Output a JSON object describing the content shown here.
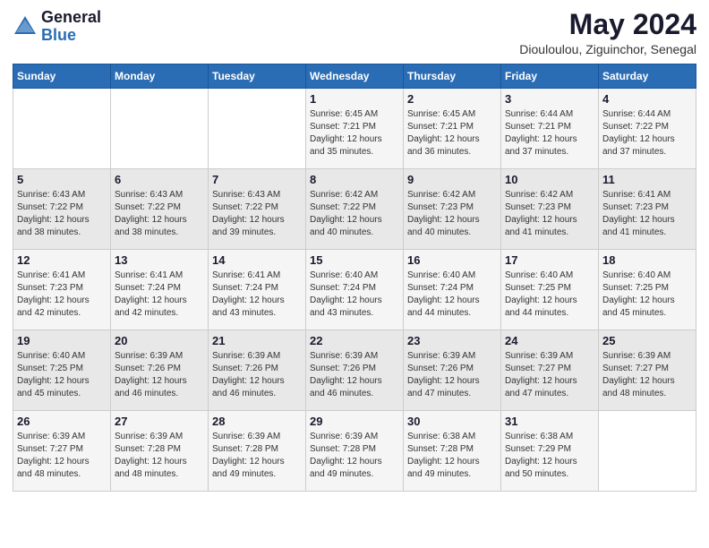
{
  "header": {
    "logo_general": "General",
    "logo_blue": "Blue",
    "title": "May 2024",
    "location": "Diouloulou, Ziguinchor, Senegal"
  },
  "days_of_week": [
    "Sunday",
    "Monday",
    "Tuesday",
    "Wednesday",
    "Thursday",
    "Friday",
    "Saturday"
  ],
  "weeks": [
    [
      {
        "day": "",
        "info": ""
      },
      {
        "day": "",
        "info": ""
      },
      {
        "day": "",
        "info": ""
      },
      {
        "day": "1",
        "info": "Sunrise: 6:45 AM\nSunset: 7:21 PM\nDaylight: 12 hours\nand 35 minutes."
      },
      {
        "day": "2",
        "info": "Sunrise: 6:45 AM\nSunset: 7:21 PM\nDaylight: 12 hours\nand 36 minutes."
      },
      {
        "day": "3",
        "info": "Sunrise: 6:44 AM\nSunset: 7:21 PM\nDaylight: 12 hours\nand 37 minutes."
      },
      {
        "day": "4",
        "info": "Sunrise: 6:44 AM\nSunset: 7:22 PM\nDaylight: 12 hours\nand 37 minutes."
      }
    ],
    [
      {
        "day": "5",
        "info": "Sunrise: 6:43 AM\nSunset: 7:22 PM\nDaylight: 12 hours\nand 38 minutes."
      },
      {
        "day": "6",
        "info": "Sunrise: 6:43 AM\nSunset: 7:22 PM\nDaylight: 12 hours\nand 38 minutes."
      },
      {
        "day": "7",
        "info": "Sunrise: 6:43 AM\nSunset: 7:22 PM\nDaylight: 12 hours\nand 39 minutes."
      },
      {
        "day": "8",
        "info": "Sunrise: 6:42 AM\nSunset: 7:22 PM\nDaylight: 12 hours\nand 40 minutes."
      },
      {
        "day": "9",
        "info": "Sunrise: 6:42 AM\nSunset: 7:23 PM\nDaylight: 12 hours\nand 40 minutes."
      },
      {
        "day": "10",
        "info": "Sunrise: 6:42 AM\nSunset: 7:23 PM\nDaylight: 12 hours\nand 41 minutes."
      },
      {
        "day": "11",
        "info": "Sunrise: 6:41 AM\nSunset: 7:23 PM\nDaylight: 12 hours\nand 41 minutes."
      }
    ],
    [
      {
        "day": "12",
        "info": "Sunrise: 6:41 AM\nSunset: 7:23 PM\nDaylight: 12 hours\nand 42 minutes."
      },
      {
        "day": "13",
        "info": "Sunrise: 6:41 AM\nSunset: 7:24 PM\nDaylight: 12 hours\nand 42 minutes."
      },
      {
        "day": "14",
        "info": "Sunrise: 6:41 AM\nSunset: 7:24 PM\nDaylight: 12 hours\nand 43 minutes."
      },
      {
        "day": "15",
        "info": "Sunrise: 6:40 AM\nSunset: 7:24 PM\nDaylight: 12 hours\nand 43 minutes."
      },
      {
        "day": "16",
        "info": "Sunrise: 6:40 AM\nSunset: 7:24 PM\nDaylight: 12 hours\nand 44 minutes."
      },
      {
        "day": "17",
        "info": "Sunrise: 6:40 AM\nSunset: 7:25 PM\nDaylight: 12 hours\nand 44 minutes."
      },
      {
        "day": "18",
        "info": "Sunrise: 6:40 AM\nSunset: 7:25 PM\nDaylight: 12 hours\nand 45 minutes."
      }
    ],
    [
      {
        "day": "19",
        "info": "Sunrise: 6:40 AM\nSunset: 7:25 PM\nDaylight: 12 hours\nand 45 minutes."
      },
      {
        "day": "20",
        "info": "Sunrise: 6:39 AM\nSunset: 7:26 PM\nDaylight: 12 hours\nand 46 minutes."
      },
      {
        "day": "21",
        "info": "Sunrise: 6:39 AM\nSunset: 7:26 PM\nDaylight: 12 hours\nand 46 minutes."
      },
      {
        "day": "22",
        "info": "Sunrise: 6:39 AM\nSunset: 7:26 PM\nDaylight: 12 hours\nand 46 minutes."
      },
      {
        "day": "23",
        "info": "Sunrise: 6:39 AM\nSunset: 7:26 PM\nDaylight: 12 hours\nand 47 minutes."
      },
      {
        "day": "24",
        "info": "Sunrise: 6:39 AM\nSunset: 7:27 PM\nDaylight: 12 hours\nand 47 minutes."
      },
      {
        "day": "25",
        "info": "Sunrise: 6:39 AM\nSunset: 7:27 PM\nDaylight: 12 hours\nand 48 minutes."
      }
    ],
    [
      {
        "day": "26",
        "info": "Sunrise: 6:39 AM\nSunset: 7:27 PM\nDaylight: 12 hours\nand 48 minutes."
      },
      {
        "day": "27",
        "info": "Sunrise: 6:39 AM\nSunset: 7:28 PM\nDaylight: 12 hours\nand 48 minutes."
      },
      {
        "day": "28",
        "info": "Sunrise: 6:39 AM\nSunset: 7:28 PM\nDaylight: 12 hours\nand 49 minutes."
      },
      {
        "day": "29",
        "info": "Sunrise: 6:39 AM\nSunset: 7:28 PM\nDaylight: 12 hours\nand 49 minutes."
      },
      {
        "day": "30",
        "info": "Sunrise: 6:38 AM\nSunset: 7:28 PM\nDaylight: 12 hours\nand 49 minutes."
      },
      {
        "day": "31",
        "info": "Sunrise: 6:38 AM\nSunset: 7:29 PM\nDaylight: 12 hours\nand 50 minutes."
      },
      {
        "day": "",
        "info": ""
      }
    ]
  ]
}
